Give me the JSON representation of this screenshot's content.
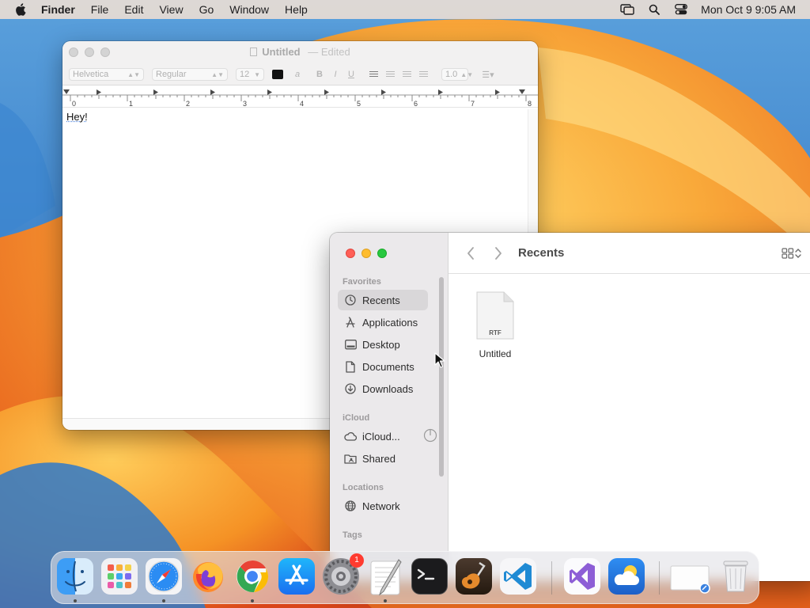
{
  "menubar": {
    "app_name": "Finder",
    "menus": [
      "File",
      "Edit",
      "View",
      "Go",
      "Window",
      "Help"
    ],
    "clock": "Mon Oct 9  9:05 AM"
  },
  "textedit": {
    "title": "Untitled",
    "title_separator": "—",
    "edited_label": "Edited",
    "font_family": "Helvetica",
    "font_style": "Regular",
    "font_size": "12",
    "bold": "B",
    "italic": "I",
    "underline": "U",
    "line_spacing": "1.0",
    "ruler_numbers": [
      "0",
      "1",
      "2",
      "3",
      "4",
      "5",
      "6",
      "7",
      "8"
    ],
    "document_text": "Hey!"
  },
  "finder": {
    "location_title": "Recents",
    "sidebar": {
      "favorites_header": "Favorites",
      "icloud_header": "iCloud",
      "locations_header": "Locations",
      "tags_header": "Tags",
      "items": {
        "recents": "Recents",
        "applications": "Applications",
        "desktop": "Desktop",
        "documents": "Documents",
        "downloads": "Downloads",
        "icloud_drive": "iCloud...",
        "shared": "Shared",
        "network": "Network"
      }
    },
    "files": [
      {
        "name": "Untitled",
        "type_label": "RTF"
      }
    ]
  },
  "dock": {
    "apps": [
      "finder",
      "launchpad",
      "safari",
      "firefox",
      "chrome",
      "app-store",
      "system-settings",
      "textedit",
      "terminal",
      "garageband",
      "vscode",
      "visual-studio",
      "weather",
      "preview",
      "trash"
    ],
    "system_settings_badge": "1"
  }
}
